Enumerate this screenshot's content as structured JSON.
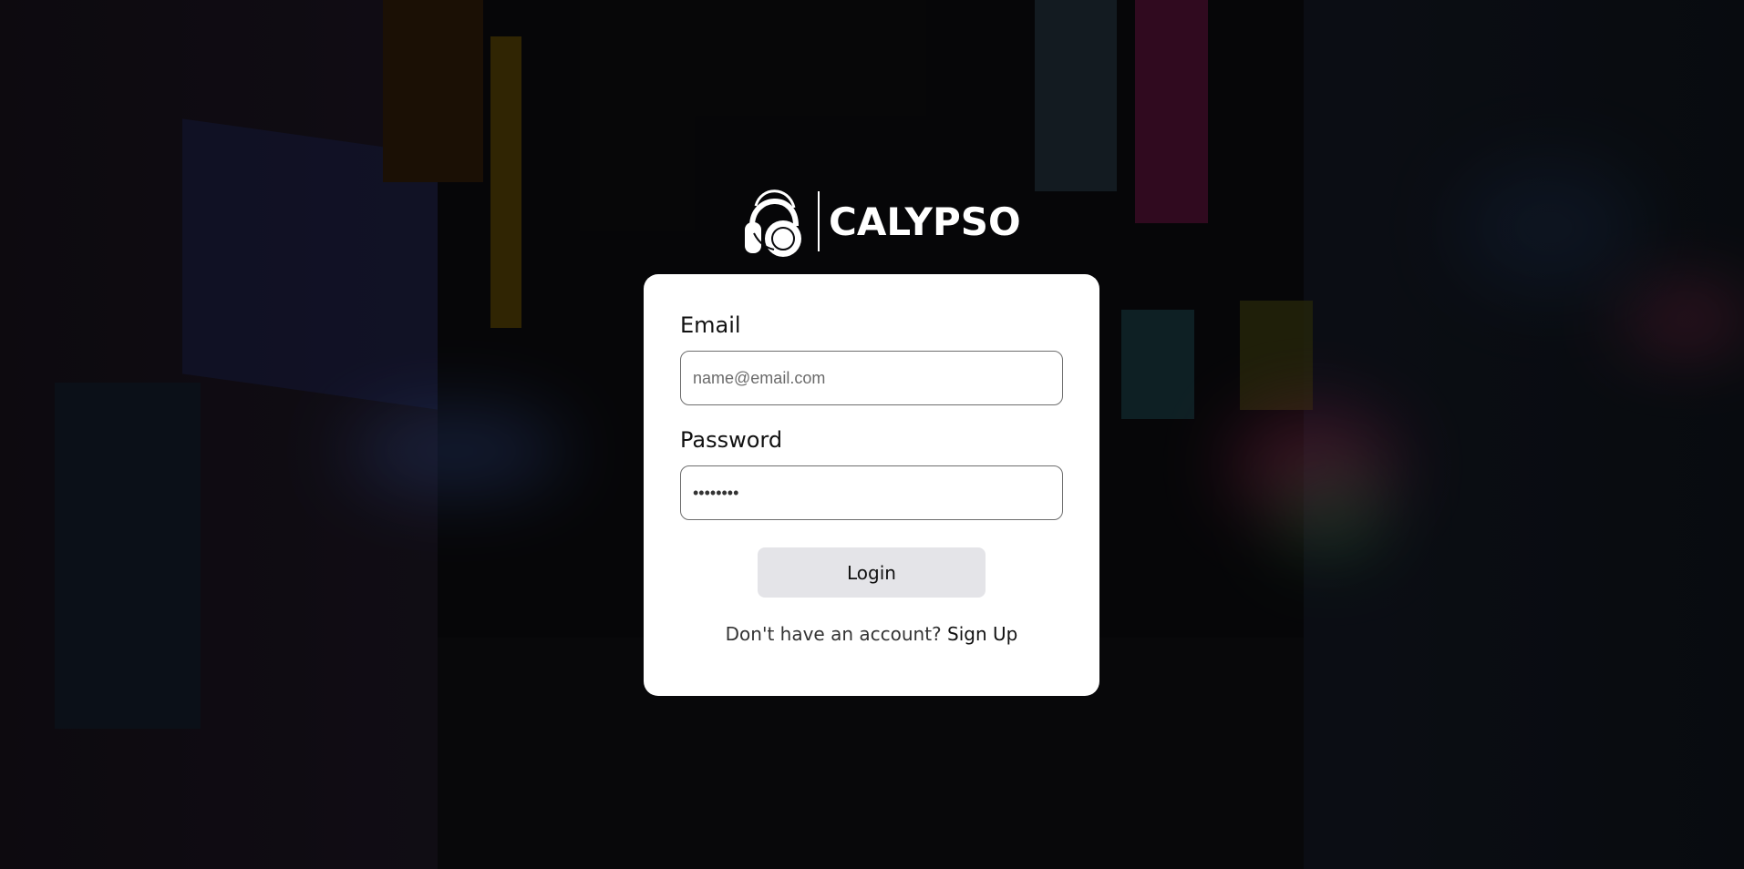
{
  "app": {
    "brand_name": "CALYPSO",
    "logo_icon": "headphones-icon"
  },
  "login_form": {
    "email_label": "Email",
    "email_placeholder": "name@email.com",
    "email_value": "",
    "password_label": "Password",
    "password_value": "••••••••",
    "login_button_label": "Login",
    "signup_prompt": "Don't have an account?",
    "signup_link_label": "Sign Up"
  },
  "colors": {
    "card_background": "#ffffff",
    "button_background": "#e4e4e8",
    "page_overlay": "#0a0a0d"
  }
}
